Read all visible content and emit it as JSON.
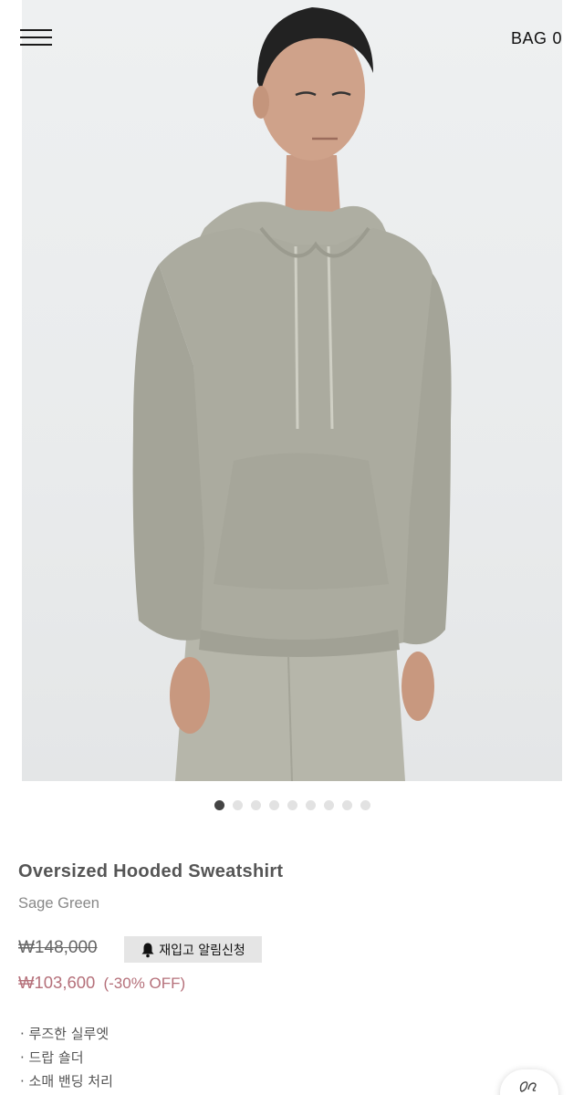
{
  "header": {
    "menu_icon": "hamburger-icon",
    "bag_label": "BAG",
    "bag_count": "0"
  },
  "gallery": {
    "image_alt": "model wearing hooded sweatshirt",
    "total_slides": 9,
    "active_slide": 1
  },
  "product": {
    "name": "Oversized Hooded Sweatshirt",
    "color": "Sage Green",
    "original_price": "₩148,000",
    "sale_price": "₩103,600",
    "discount": "(-30% OFF)",
    "restock_label": "재입고 알림신청",
    "restock_icon": "bell-icon",
    "features": [
      "루즈한 실루엣",
      "드랍 숄더",
      "소매 밴딩 처리"
    ]
  },
  "colors": {
    "sale": "#b5707a",
    "garment": "#a8a89c",
    "background": "#ffffff"
  },
  "chat": {
    "icon": "chat-icon"
  }
}
